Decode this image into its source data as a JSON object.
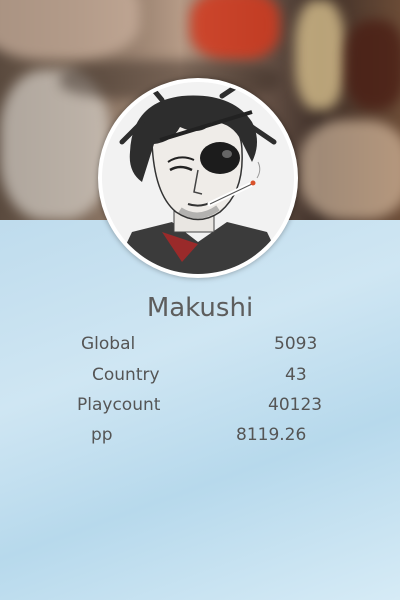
{
  "profile": {
    "username": "Makushi"
  },
  "stats": [
    {
      "label": "Global",
      "value": "5093"
    },
    {
      "label": "Country",
      "value": "43"
    },
    {
      "label": "Playcount",
      "value": "40123"
    },
    {
      "label": "pp",
      "value": "8119.26"
    }
  ],
  "colors": {
    "text": "#555555",
    "background_blue": "#c6e1f0"
  }
}
